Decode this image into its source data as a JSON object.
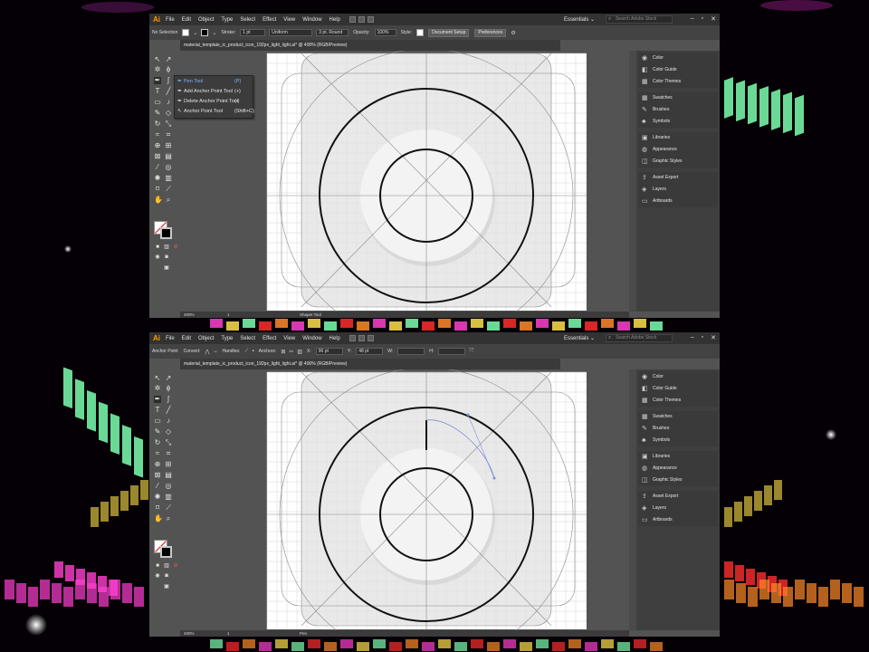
{
  "background_colors": {
    "stage": "#050006",
    "green": "#7dffb0",
    "pink": "#ff3fd0",
    "red": "#ff2d2d",
    "yellow": "#ffe14a",
    "orange": "#ff8a2a"
  },
  "top": {
    "app_logo": "Ai",
    "menu": [
      "File",
      "Edit",
      "Object",
      "Type",
      "Select",
      "Effect",
      "View",
      "Window",
      "Help"
    ],
    "workspace": "Essentials ⌄",
    "search_placeholder": "Search Adobe Stock",
    "window_controls": [
      "–",
      "▫",
      "✕"
    ],
    "control_bar": {
      "selection": "No Selection",
      "stroke_label": "Stroke:",
      "stroke_weight": "1 pt",
      "profile": "Uniform",
      "brush": "3 pt. Round",
      "opacity_label": "Opacity:",
      "opacity_value": "100%",
      "style_label": "Style:",
      "doc_setup": "Document Setup",
      "preferences": "Preferences"
    },
    "doc_tab": "material_template_ic_product_icon_192px_light_light.ai* @ 400% (RGB/Preview)",
    "flyout": [
      {
        "icon": "✒",
        "name": "Pen Tool",
        "key": "(P)",
        "selected": true
      },
      {
        "icon": "✒",
        "name": "Add Anchor Point Tool",
        "key": "(+)",
        "selected": false
      },
      {
        "icon": "✒",
        "name": "Delete Anchor Point Tool",
        "key": "(-)",
        "selected": false
      },
      {
        "icon": "↖",
        "name": "Anchor Point Tool",
        "key": "(Shift+C)",
        "selected": false
      }
    ],
    "status": {
      "zoom": "400%",
      "page": "1",
      "tool": "Shaper Tool"
    }
  },
  "bottom": {
    "app_logo": "Ai",
    "menu": [
      "File",
      "Edit",
      "Object",
      "Type",
      "Select",
      "Effect",
      "View",
      "Window",
      "Help"
    ],
    "workspace": "Essentials ⌄",
    "search_placeholder": "Search Adobe Stock",
    "window_controls": [
      "–",
      "▫",
      "✕"
    ],
    "control_bar": {
      "selection": "Anchor Point",
      "convert_label": "Convert:",
      "handles_label": "Handles:",
      "anchors_label": "Anchors:",
      "x_label": "X:",
      "x_value": "96 pt",
      "y_label": "Y:",
      "y_value": "48 pt",
      "w_label": "W:",
      "h_label": "H:"
    },
    "doc_tab": "material_template_ic_product_icon_192px_light_light.ai* @ 400% (RGB/Preview)",
    "status": {
      "zoom": "400%",
      "page": "1",
      "tool": "Pen"
    }
  },
  "panels": [
    [
      {
        "icon": "◉",
        "label": "Color"
      },
      {
        "icon": "◧",
        "label": "Color Guide"
      },
      {
        "icon": "▦",
        "label": "Color Themes"
      }
    ],
    [
      {
        "icon": "▦",
        "label": "Swatches"
      },
      {
        "icon": "✎",
        "label": "Brushes"
      },
      {
        "icon": "♣",
        "label": "Symbols"
      }
    ],
    [
      {
        "icon": "▣",
        "label": "Libraries"
      },
      {
        "icon": "◍",
        "label": "Appearance"
      },
      {
        "icon": "◫",
        "label": "Graphic Styles"
      }
    ],
    [
      {
        "icon": "⇪",
        "label": "Asset Export"
      },
      {
        "icon": "◈",
        "label": "Layers"
      },
      {
        "icon": "▭",
        "label": "Artboards"
      }
    ]
  ],
  "artwork": {
    "art_circle_stroke": "#111111",
    "guide_stroke": "#8a8a8a",
    "path_preview": "#7a8fd8"
  }
}
